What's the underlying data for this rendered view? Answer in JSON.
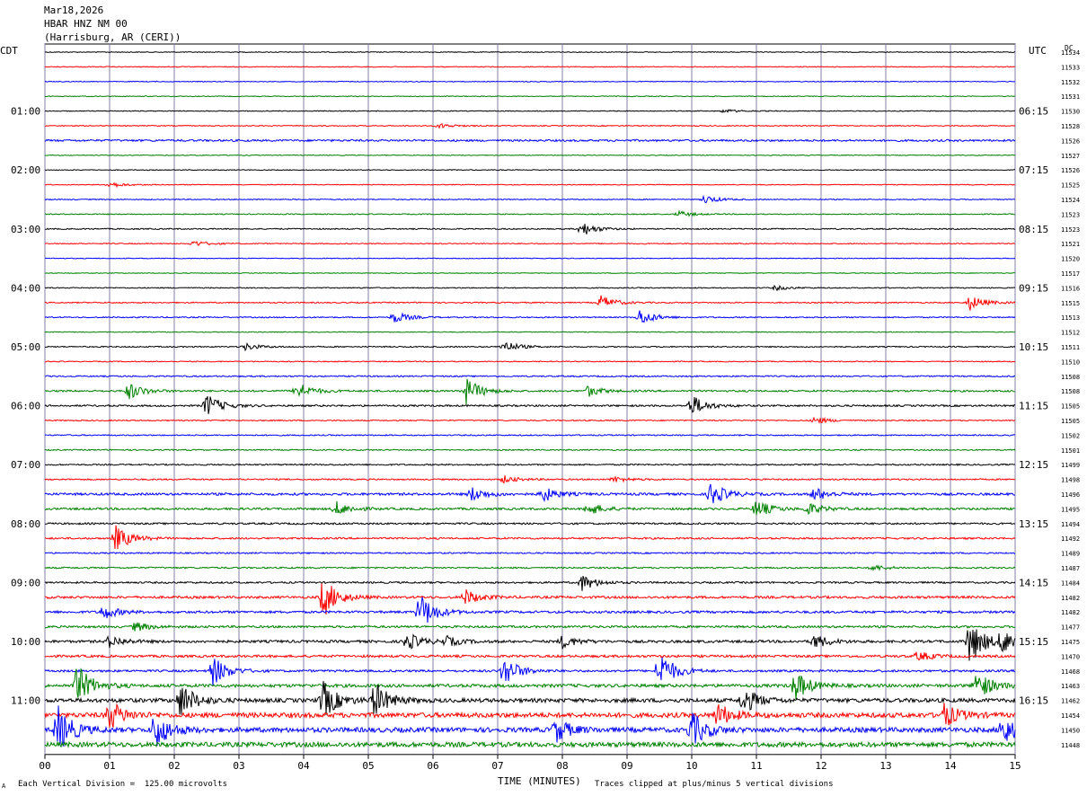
{
  "header": {
    "date": "Mar18,2026",
    "station": "HBAR HNZ NM 00",
    "location": "(Harrisburg, AR (CERI))"
  },
  "left_tz": "CDT",
  "right_tz": "UTC",
  "dc_label": "DC",
  "footer": {
    "vertical_division": "Each Vertical Division =  125.00 microvolts",
    "xlabel": "TIME (MINUTES)",
    "clip_note": "Traces clipped at plus/minus 5 vertical divisions",
    "corner_mark": "A"
  },
  "colors": {
    "cycle": [
      "#000000",
      "#ff0000",
      "#0000ff",
      "#008000"
    ],
    "grid": "#8080a0"
  },
  "chart_data": {
    "type": "line",
    "title": "",
    "xlabel": "TIME (MINUTES)",
    "xlim": [
      0,
      15
    ],
    "x_ticks": [
      "00",
      "01",
      "02",
      "03",
      "04",
      "05",
      "06",
      "07",
      "08",
      "09",
      "10",
      "11",
      "12",
      "13",
      "14",
      "15"
    ],
    "row_count": 48,
    "rows_per_hour": 4,
    "left_hour_labels": [
      "01:00",
      "02:00",
      "03:00",
      "04:00",
      "05:00",
      "06:00",
      "07:00",
      "08:00",
      "09:00",
      "10:00",
      "11:00"
    ],
    "right_hour_labels": [
      "06:15",
      "07:15",
      "08:15",
      "09:15",
      "10:15",
      "11:15",
      "12:15",
      "13:15",
      "14:15",
      "15:15",
      "16:15"
    ],
    "dc_offsets": [
      11534,
      11533,
      11532,
      11531,
      11530,
      11528,
      11526,
      11527,
      11526,
      11525,
      11524,
      11523,
      11523,
      11521,
      11520,
      11517,
      11516,
      11515,
      11513,
      11512,
      11511,
      11510,
      11508,
      11508,
      11505,
      11505,
      11502,
      11501,
      11499,
      11498,
      11496,
      11495,
      11494,
      11492,
      11489,
      11487,
      11484,
      11482,
      11482,
      11477,
      11475,
      11470,
      11468,
      11463,
      11462,
      11454,
      11450,
      11448
    ],
    "row_activity": [
      0.4,
      0.4,
      0.4,
      0.4,
      0.4,
      0.5,
      1.0,
      0.4,
      0.4,
      0.4,
      0.5,
      0.5,
      0.6,
      0.5,
      0.4,
      0.4,
      0.5,
      0.6,
      0.6,
      0.4,
      0.6,
      0.5,
      0.7,
      0.9,
      0.9,
      0.6,
      0.6,
      0.6,
      0.7,
      0.7,
      1.2,
      1.1,
      0.9,
      0.9,
      0.7,
      0.8,
      0.9,
      1.2,
      1.2,
      1.1,
      1.3,
      1.2,
      1.1,
      1.6,
      2.0,
      2.4,
      2.4,
      2.4
    ],
    "events": [
      {
        "row": 4,
        "minute": 10.5,
        "amp": 0.3
      },
      {
        "row": 5,
        "minute": 6.1,
        "amp": 0.4
      },
      {
        "row": 9,
        "minute": 1.0,
        "amp": 0.5
      },
      {
        "row": 10,
        "minute": 10.2,
        "amp": 0.7
      },
      {
        "row": 11,
        "minute": 9.8,
        "amp": 0.5
      },
      {
        "row": 12,
        "minute": 8.3,
        "amp": 1.2
      },
      {
        "row": 13,
        "minute": 2.3,
        "amp": 0.5
      },
      {
        "row": 16,
        "minute": 11.3,
        "amp": 0.4
      },
      {
        "row": 17,
        "minute": 8.6,
        "amp": 1.2
      },
      {
        "row": 17,
        "minute": 14.3,
        "amp": 1.3
      },
      {
        "row": 18,
        "minute": 5.4,
        "amp": 1.0
      },
      {
        "row": 18,
        "minute": 9.2,
        "amp": 1.4
      },
      {
        "row": 20,
        "minute": 3.1,
        "amp": 0.6
      },
      {
        "row": 20,
        "minute": 7.1,
        "amp": 1.0
      },
      {
        "row": 23,
        "minute": 1.3,
        "amp": 1.4
      },
      {
        "row": 23,
        "minute": 3.9,
        "amp": 1.5
      },
      {
        "row": 23,
        "minute": 6.5,
        "amp": 2.4
      },
      {
        "row": 23,
        "minute": 8.4,
        "amp": 0.9
      },
      {
        "row": 24,
        "minute": 2.5,
        "amp": 2.0
      },
      {
        "row": 24,
        "minute": 10.0,
        "amp": 1.8
      },
      {
        "row": 25,
        "minute": 11.9,
        "amp": 0.6
      },
      {
        "row": 29,
        "minute": 7.1,
        "amp": 0.6
      },
      {
        "row": 29,
        "minute": 8.8,
        "amp": 0.5
      },
      {
        "row": 30,
        "minute": 6.6,
        "amp": 1.2
      },
      {
        "row": 30,
        "minute": 7.7,
        "amp": 1.3
      },
      {
        "row": 30,
        "minute": 10.3,
        "amp": 2.0
      },
      {
        "row": 30,
        "minute": 11.9,
        "amp": 1.1
      },
      {
        "row": 31,
        "minute": 4.5,
        "amp": 1.2
      },
      {
        "row": 31,
        "minute": 8.4,
        "amp": 1.1
      },
      {
        "row": 31,
        "minute": 11.0,
        "amp": 1.5
      },
      {
        "row": 31,
        "minute": 11.8,
        "amp": 1.0
      },
      {
        "row": 33,
        "minute": 1.1,
        "amp": 2.2
      },
      {
        "row": 35,
        "minute": 12.8,
        "amp": 0.5
      },
      {
        "row": 36,
        "minute": 8.3,
        "amp": 1.4
      },
      {
        "row": 37,
        "minute": 4.3,
        "amp": 3.5
      },
      {
        "row": 37,
        "minute": 6.5,
        "amp": 1.3
      },
      {
        "row": 38,
        "minute": 0.9,
        "amp": 1.2
      },
      {
        "row": 38,
        "minute": 5.8,
        "amp": 3.2
      },
      {
        "row": 39,
        "minute": 1.4,
        "amp": 0.8
      },
      {
        "row": 40,
        "minute": 1.0,
        "amp": 1.0
      },
      {
        "row": 40,
        "minute": 5.6,
        "amp": 1.5
      },
      {
        "row": 40,
        "minute": 6.2,
        "amp": 0.8
      },
      {
        "row": 40,
        "minute": 8.0,
        "amp": 1.1
      },
      {
        "row": 40,
        "minute": 11.9,
        "amp": 1.2
      },
      {
        "row": 40,
        "minute": 14.3,
        "amp": 4.0
      },
      {
        "row": 40,
        "minute": 14.8,
        "amp": 2.0
      },
      {
        "row": 41,
        "minute": 13.5,
        "amp": 0.8
      },
      {
        "row": 42,
        "minute": 2.6,
        "amp": 2.6
      },
      {
        "row": 42,
        "minute": 7.1,
        "amp": 2.6
      },
      {
        "row": 42,
        "minute": 9.5,
        "amp": 3.5
      },
      {
        "row": 43,
        "minute": 0.5,
        "amp": 3.5
      },
      {
        "row": 43,
        "minute": 11.6,
        "amp": 2.5
      },
      {
        "row": 43,
        "minute": 14.4,
        "amp": 2.6
      },
      {
        "row": 44,
        "minute": 2.1,
        "amp": 3.0
      },
      {
        "row": 44,
        "minute": 4.3,
        "amp": 3.2
      },
      {
        "row": 44,
        "minute": 5.1,
        "amp": 3.0
      },
      {
        "row": 44,
        "minute": 10.8,
        "amp": 2.2
      },
      {
        "row": 45,
        "minute": 1.0,
        "amp": 2.5
      },
      {
        "row": 45,
        "minute": 10.4,
        "amp": 2.0
      },
      {
        "row": 45,
        "minute": 13.9,
        "amp": 2.0
      },
      {
        "row": 46,
        "minute": 0.2,
        "amp": 4.0
      },
      {
        "row": 46,
        "minute": 1.7,
        "amp": 3.2
      },
      {
        "row": 46,
        "minute": 7.9,
        "amp": 2.0
      },
      {
        "row": 46,
        "minute": 10.0,
        "amp": 3.0
      },
      {
        "row": 46,
        "minute": 14.8,
        "amp": 2.5
      }
    ]
  }
}
